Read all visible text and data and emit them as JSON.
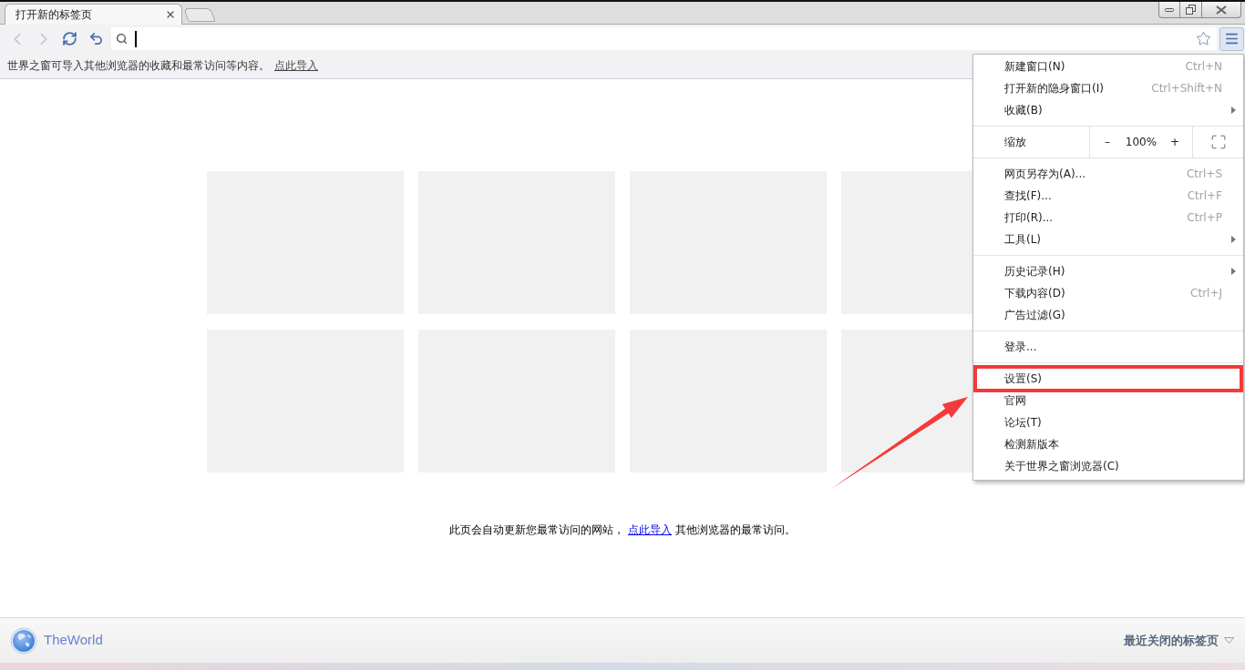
{
  "tabs": [
    {
      "title": "打开新的标签页",
      "selected": true
    }
  ],
  "toolbar": {
    "back": {
      "disabled": true
    },
    "forward": {
      "disabled": true
    }
  },
  "info_bar": {
    "message": "世界之窗可导入其他浏览器的收藏和最常访问等内容。",
    "link": "点此导入"
  },
  "notice": {
    "before": "此页会自动更新您最常访问的网站，",
    "link": "点此导入",
    "after": "其他浏览器的最常访问。"
  },
  "menu": {
    "open": true,
    "groups": [
      {
        "kind": "items",
        "items": [
          {
            "label": "新建窗口(N)",
            "shortcut": "Ctrl+N",
            "submenu": false,
            "highlighted": false
          },
          {
            "label": "打开新的隐身窗口(I)",
            "shortcut": "Ctrl+Shift+N",
            "submenu": false,
            "highlighted": false
          },
          {
            "label": "收藏(B)",
            "submenu": true,
            "highlighted": false
          }
        ]
      },
      {
        "kind": "zoom",
        "label": "缩放",
        "decrease": "–",
        "value": "100%",
        "increase": "+"
      },
      {
        "kind": "items",
        "items": [
          {
            "label": "网页另存为(A)...",
            "shortcut": "Ctrl+S",
            "submenu": false,
            "highlighted": false
          },
          {
            "label": "查找(F)...",
            "shortcut": "Ctrl+F",
            "submenu": false,
            "highlighted": false
          },
          {
            "label": "打印(R)...",
            "shortcut": "Ctrl+P",
            "submenu": false,
            "highlighted": false
          },
          {
            "label": "工具(L)",
            "submenu": true,
            "highlighted": false
          }
        ]
      },
      {
        "kind": "items",
        "items": [
          {
            "label": "历史记录(H)",
            "submenu": true,
            "highlighted": false
          },
          {
            "label": "下载内容(D)",
            "shortcut": "Ctrl+J",
            "submenu": false,
            "highlighted": false
          },
          {
            "label": "广告过滤(G)",
            "submenu": false,
            "highlighted": false
          }
        ]
      },
      {
        "kind": "items",
        "items": [
          {
            "label": "登录...",
            "submenu": false,
            "highlighted": false
          }
        ]
      },
      {
        "kind": "items",
        "items": [
          {
            "label": "设置(S)",
            "submenu": false,
            "highlighted": true
          },
          {
            "label": "官网",
            "submenu": false,
            "highlighted": false
          },
          {
            "label": "论坛(T)",
            "submenu": false,
            "highlighted": false
          },
          {
            "label": "检测新版本",
            "submenu": false,
            "highlighted": false
          },
          {
            "label": "关于世界之窗浏览器(C)",
            "submenu": false,
            "highlighted": false
          }
        ]
      }
    ]
  },
  "bottom_bar": {
    "brand": "TheWorld",
    "recently_closed": "最近关闭的标签页"
  }
}
